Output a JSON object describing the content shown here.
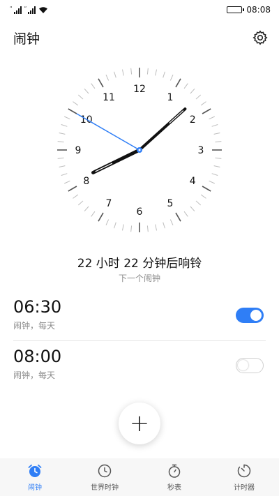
{
  "status_bar": {
    "time": "08:08",
    "signal1_label": "4G",
    "signal2_label": "4G"
  },
  "header": {
    "title": "闹钟",
    "settings_icon": "gear-icon"
  },
  "clock": {
    "numbers": [
      "12",
      "1",
      "2",
      "3",
      "4",
      "5",
      "6",
      "7",
      "8",
      "9",
      "10",
      "11"
    ],
    "hour_hand_minutes": 488,
    "minute_hand_minutes": 8,
    "second_hand_seconds": 50,
    "accent_color": "#2f7ef6"
  },
  "next_alarm": {
    "countdown": "22 小时  22 分钟后响铃",
    "label": "下一个闹钟"
  },
  "alarms": [
    {
      "time": "06:30",
      "detail": "闹钟，每天",
      "enabled": true
    },
    {
      "time": "08:00",
      "detail": "闹钟，每天",
      "enabled": false
    }
  ],
  "fab": {
    "label": "+"
  },
  "bottom_nav": [
    {
      "label": "闹钟",
      "icon": "alarm-clock-icon",
      "active": true
    },
    {
      "label": "世界时钟",
      "icon": "clock-icon",
      "active": false
    },
    {
      "label": "秒表",
      "icon": "stopwatch-icon",
      "active": false
    },
    {
      "label": "计时器",
      "icon": "timer-icon",
      "active": false
    }
  ],
  "colors": {
    "accent": "#2f7ef6",
    "secondary_text": "#8a8a8a"
  }
}
